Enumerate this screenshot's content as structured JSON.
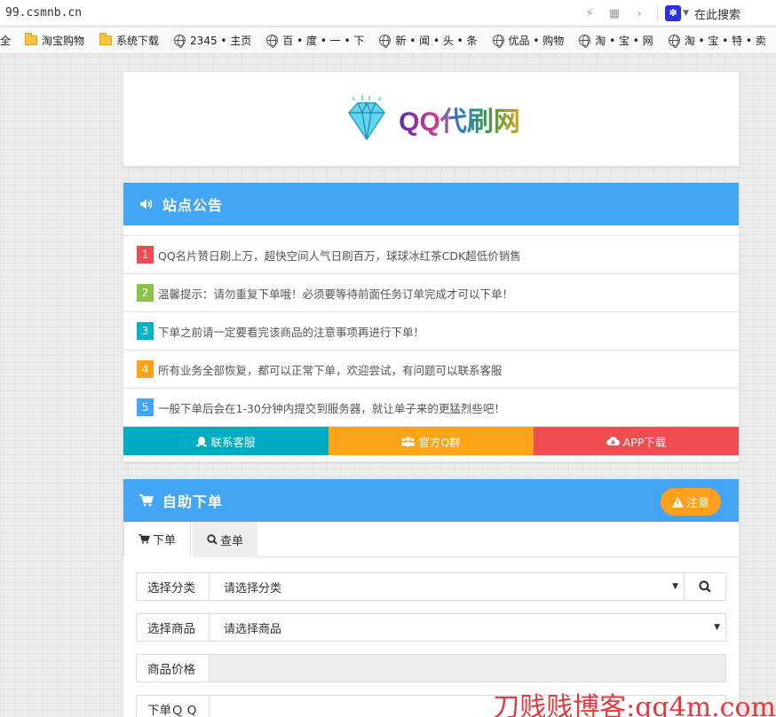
{
  "browser": {
    "url": "99.csmnb.cn",
    "search_placeholder": "在此搜索",
    "bookmarks": [
      {
        "label": "全",
        "icon": "folder-icon"
      },
      {
        "label": "淘宝购物",
        "icon": "folder-icon"
      },
      {
        "label": "系统下载",
        "icon": "folder-icon"
      },
      {
        "label": "2345 • 主页",
        "icon": "globe-icon"
      },
      {
        "label": "百 • 度 • 一 • 下",
        "icon": "globe-icon"
      },
      {
        "label": "新 • 闻 • 头 • 条",
        "icon": "globe-icon"
      },
      {
        "label": "优品 • 购物",
        "icon": "globe-icon"
      },
      {
        "label": "淘 • 宝 • 网",
        "icon": "globe-icon"
      },
      {
        "label": "淘 • 宝 • 特 • 卖",
        "icon": "globe-icon"
      }
    ]
  },
  "logo": {
    "text": "QQ代刷网",
    "icon": "diamond-icon"
  },
  "notice": {
    "title": "站点公告",
    "icon": "volume-icon",
    "items": [
      {
        "num": "1",
        "color": "#ef4d4f",
        "text": "QQ名片赞日刷上万，超快空间人气日刷百万，球球冰红茶CDK超低价销售"
      },
      {
        "num": "2",
        "color": "#8bc34a",
        "text": "温馨提示：请勿重复下单哦！必须要等待前面任务订单完成才可以下单！"
      },
      {
        "num": "3",
        "color": "#00b5c7",
        "text": "下单之前请一定要看完该商品的注意事项再进行下单！"
      },
      {
        "num": "4",
        "color": "#ffa31a",
        "text": "所有业务全部恢复，都可以正常下单，欢迎尝试，有问题可以联系客服"
      },
      {
        "num": "5",
        "color": "#42a5f5",
        "text": "一般下单后会在1-30分钟内提交到服务器，就让单子来的更猛烈些吧！"
      }
    ],
    "buttons": [
      {
        "label": "联系客服",
        "color": "#00acc1",
        "icon": "qq-penguin-icon"
      },
      {
        "label": "官方Q群",
        "color": "#ffa31a",
        "icon": "users-icon"
      },
      {
        "label": "APP下载",
        "color": "#ef4d4f",
        "icon": "cloud-download-icon"
      }
    ]
  },
  "order": {
    "title": "自助下单",
    "icon": "cart-icon",
    "warn_label": "注意",
    "tabs": [
      {
        "label": "下单",
        "icon": "cart-icon"
      },
      {
        "label": "查单",
        "icon": "search-icon"
      }
    ],
    "fields": {
      "category": {
        "label": "选择分类",
        "value": "请选择分类"
      },
      "product": {
        "label": "选择商品",
        "value": "请选择商品"
      },
      "price": {
        "label": "商品价格",
        "value": ""
      },
      "qq": {
        "label": "下单Ｑ Q"
      }
    }
  },
  "watermark": "刀贱贱博客:qq4m.com"
}
